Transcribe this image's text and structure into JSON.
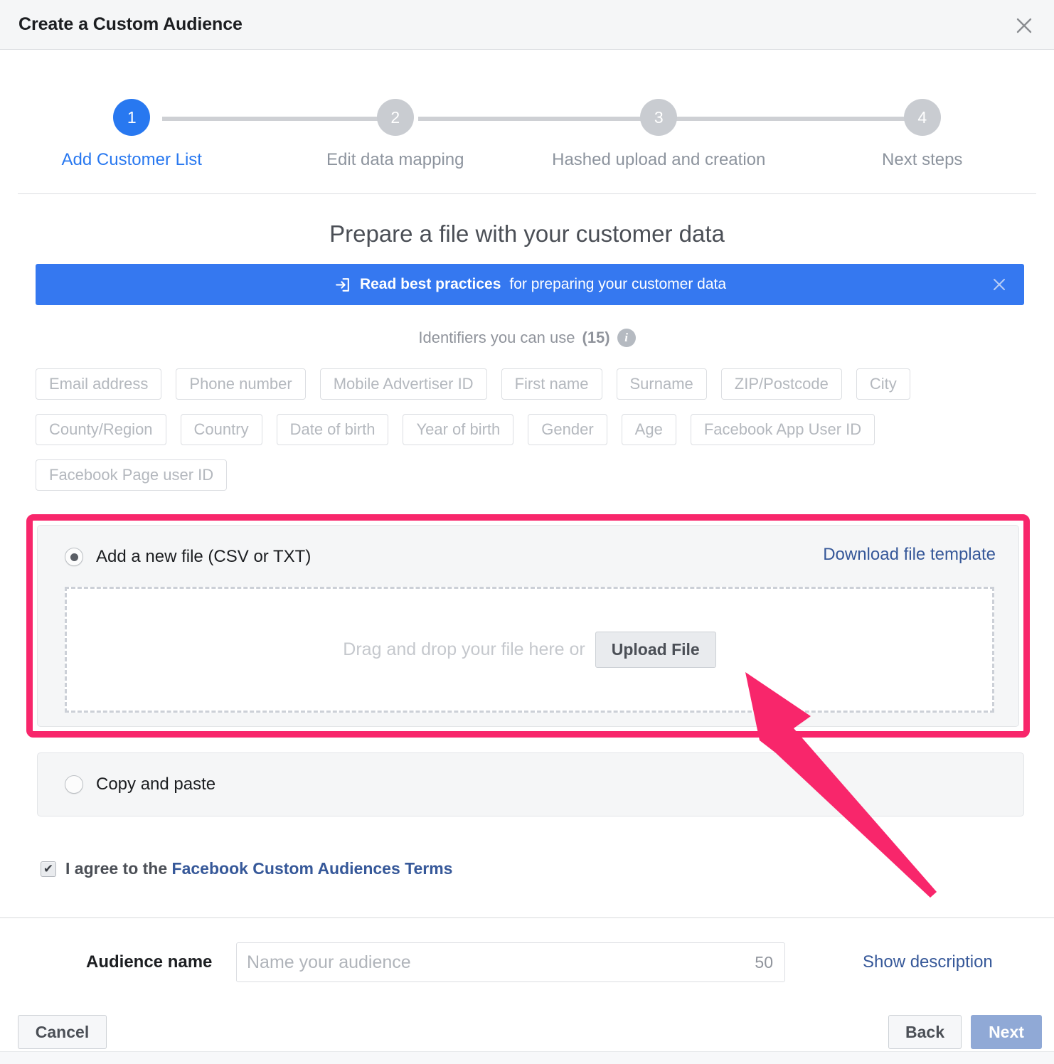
{
  "window": {
    "title": "Create a Custom Audience",
    "close_icon": "close-icon"
  },
  "stepper": {
    "steps": [
      {
        "number": "1",
        "label": "Add Customer List",
        "state": "active"
      },
      {
        "number": "2",
        "label": "Edit data mapping",
        "state": "inactive"
      },
      {
        "number": "3",
        "label": "Hashed upload and creation",
        "state": "inactive"
      },
      {
        "number": "4",
        "label": "Next steps",
        "state": "inactive"
      }
    ],
    "active_color": "#2878f0",
    "inactive_color": "#c9ccd1"
  },
  "main": {
    "page_title": "Prepare a file with your customer data",
    "banner": {
      "icon": "external-link-icon",
      "link_text": "Read best practices",
      "rest_text": " for preparing your customer data",
      "close_icon": "close-icon",
      "background": "#3578f0"
    },
    "identifiers": {
      "heading_text": "Identifiers you can use",
      "count": "(15)",
      "info_icon": "info-icon",
      "chips": [
        "Email address",
        "Phone number",
        "Mobile Advertiser ID",
        "First name",
        "Surname",
        "ZIP/Postcode",
        "City",
        "County/Region",
        "Country",
        "Date of birth",
        "Year of birth",
        "Gender",
        "Age",
        "Facebook App User ID",
        "Facebook Page user ID"
      ]
    },
    "upload_option": {
      "radio_label": "Add a new file (CSV or TXT)",
      "selected": "true",
      "download_link": "Download file template",
      "dropzone_text": "Drag and drop your file here or",
      "upload_button": "Upload File",
      "highlight_color": "#f8266b"
    },
    "paste_option": {
      "radio_label": "Copy and paste",
      "selected": "false"
    },
    "terms": {
      "checked": "true",
      "prefix": "I agree to the ",
      "link": "Facebook Custom Audiences Terms"
    }
  },
  "footer": {
    "audience_name_label": "Audience name",
    "audience_name_value": "",
    "audience_name_placeholder": "Name your audience",
    "char_count": "50",
    "show_description": "Show description",
    "cancel_label": "Cancel",
    "back_label": "Back",
    "next_label": "Next"
  },
  "annotation": {
    "arrow_color": "#f8266b",
    "points_to": "Upload File"
  }
}
